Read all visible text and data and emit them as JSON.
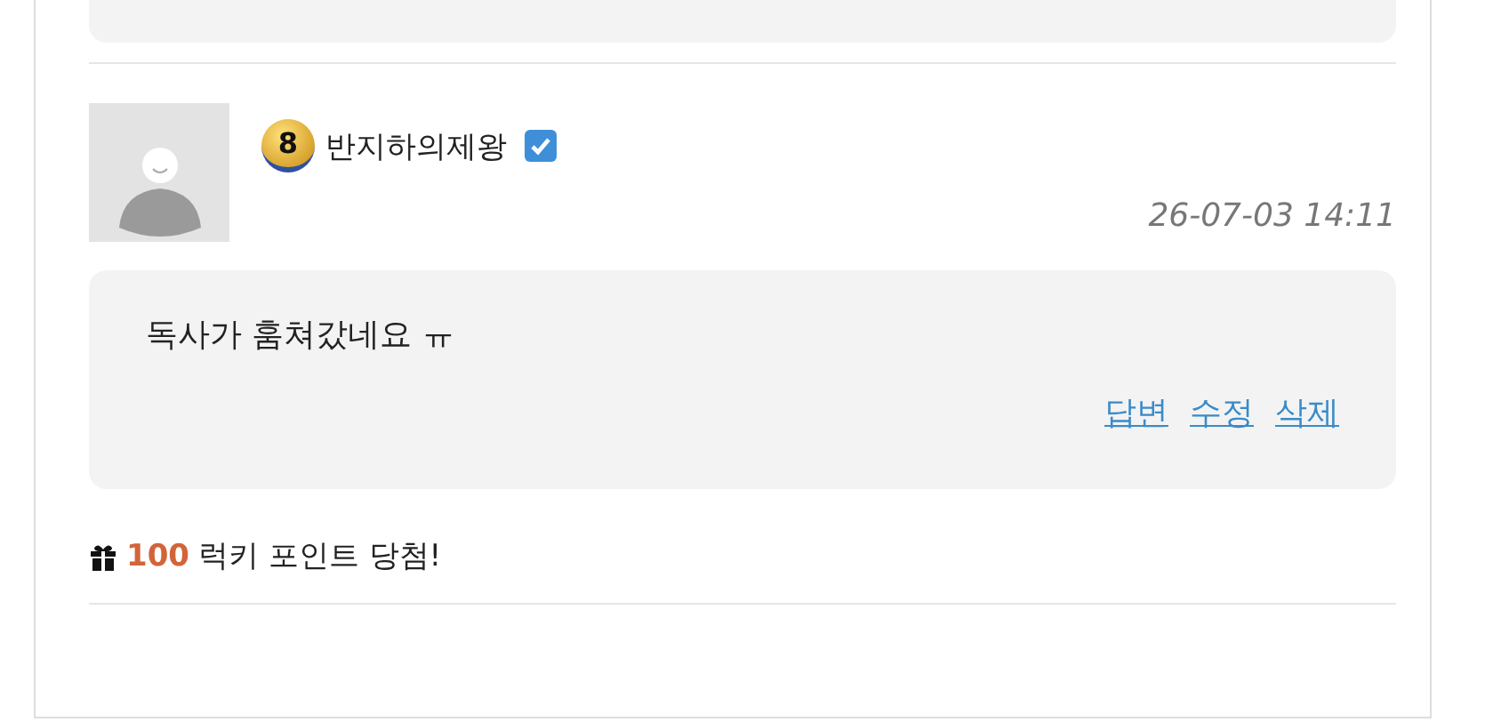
{
  "comment": {
    "level_badge": "8",
    "author": "반지하의제왕",
    "verified": true,
    "date": "26-07-03 14:11",
    "body": "독사가 훔쳐갔네요 ㅠ",
    "actions": [
      {
        "label": "답변"
      },
      {
        "label": "수정"
      },
      {
        "label": "삭제"
      }
    ]
  },
  "reward": {
    "points": "100",
    "text": "럭키 포인트 당첨!"
  }
}
